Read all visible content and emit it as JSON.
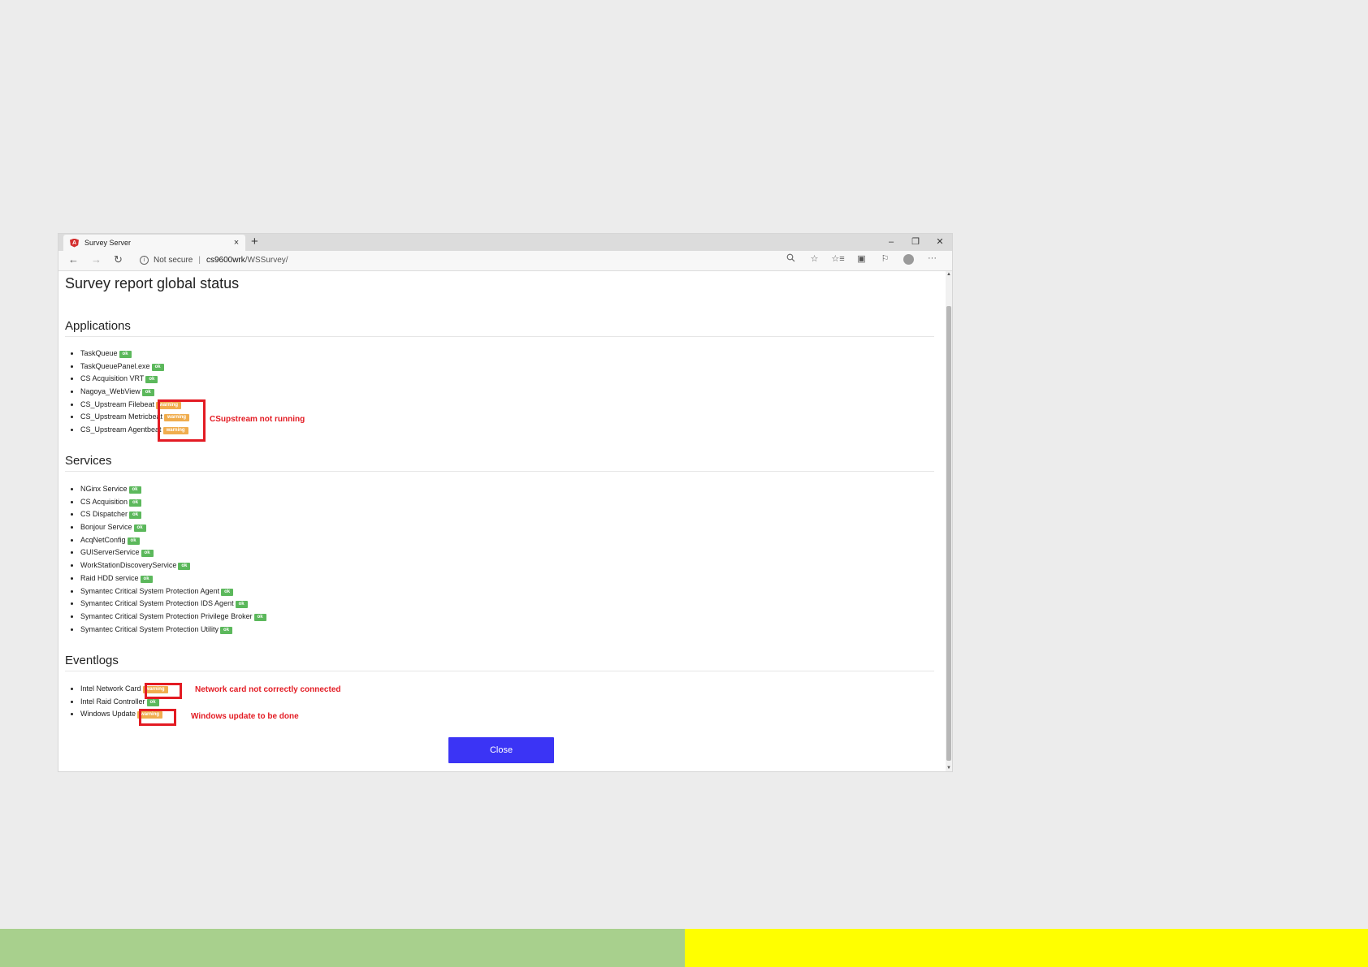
{
  "browser": {
    "tab_title": "Survey Server",
    "tab_close": "×",
    "new_tab": "+",
    "window_controls": {
      "minimize": "–",
      "restore": "❐",
      "close": "✕"
    },
    "nav": {
      "back": "←",
      "forward": "→",
      "refresh": "↻"
    },
    "address": {
      "security_label": "Not secure",
      "url_host": "cs9600wrk",
      "url_path": "/WSSurvey/"
    },
    "toolbar_icons": [
      "zoom-icon",
      "star-icon",
      "favorites-icon",
      "collections-icon",
      "extensions-icon",
      "profile-icon",
      "more-icon"
    ],
    "more_label": "···"
  },
  "report": {
    "title": "Survey report global status",
    "sections": {
      "applications": {
        "title": "Applications",
        "items": [
          {
            "name": "TaskQueue",
            "status": "ok"
          },
          {
            "name": "TaskQueuePanel.exe",
            "status": "ok"
          },
          {
            "name": "CS Acquisition VRT",
            "status": "ok"
          },
          {
            "name": "Nagoya_WebView",
            "status": "ok"
          },
          {
            "name": "CS_Upstream Filebeat",
            "status": "warning"
          },
          {
            "name": "CS_Upstream Metricbeat",
            "status": "warning"
          },
          {
            "name": "CS_Upstream Agentbeat",
            "status": "warning"
          }
        ]
      },
      "services": {
        "title": "Services",
        "items": [
          {
            "name": "NGinx Service",
            "status": "ok"
          },
          {
            "name": "CS Acquisition",
            "status": "ok"
          },
          {
            "name": "CS Dispatcher",
            "status": "ok"
          },
          {
            "name": "Bonjour Service",
            "status": "ok"
          },
          {
            "name": "AcqNetConfig",
            "status": "ok"
          },
          {
            "name": "GUIServerService",
            "status": "ok"
          },
          {
            "name": "WorkStationDiscoveryService",
            "status": "ok"
          },
          {
            "name": "Raid HDD service",
            "status": "ok"
          },
          {
            "name": "Symantec Critical System Protection Agent",
            "status": "ok"
          },
          {
            "name": "Symantec Critical System Protection IDS Agent",
            "status": "ok"
          },
          {
            "name": "Symantec Critical System Protection Privilege Broker",
            "status": "ok"
          },
          {
            "name": "Symantec Critical System Protection Utility",
            "status": "ok"
          }
        ]
      },
      "eventlogs": {
        "title": "Eventlogs",
        "items": [
          {
            "name": "Intel Network Card",
            "status": "warning"
          },
          {
            "name": "Intel Raid Controller",
            "status": "ok"
          },
          {
            "name": "Windows Update",
            "status": "warning"
          }
        ]
      }
    },
    "close_label": "Close"
  },
  "annotations": {
    "csupstream": "CSupstream not running",
    "network": "Network card not correctly connected",
    "windows_update": "Windows update to be done",
    "color": "#e31b23"
  },
  "footer_colors": {
    "left": "#a8d08d",
    "right": "#ffff00"
  }
}
